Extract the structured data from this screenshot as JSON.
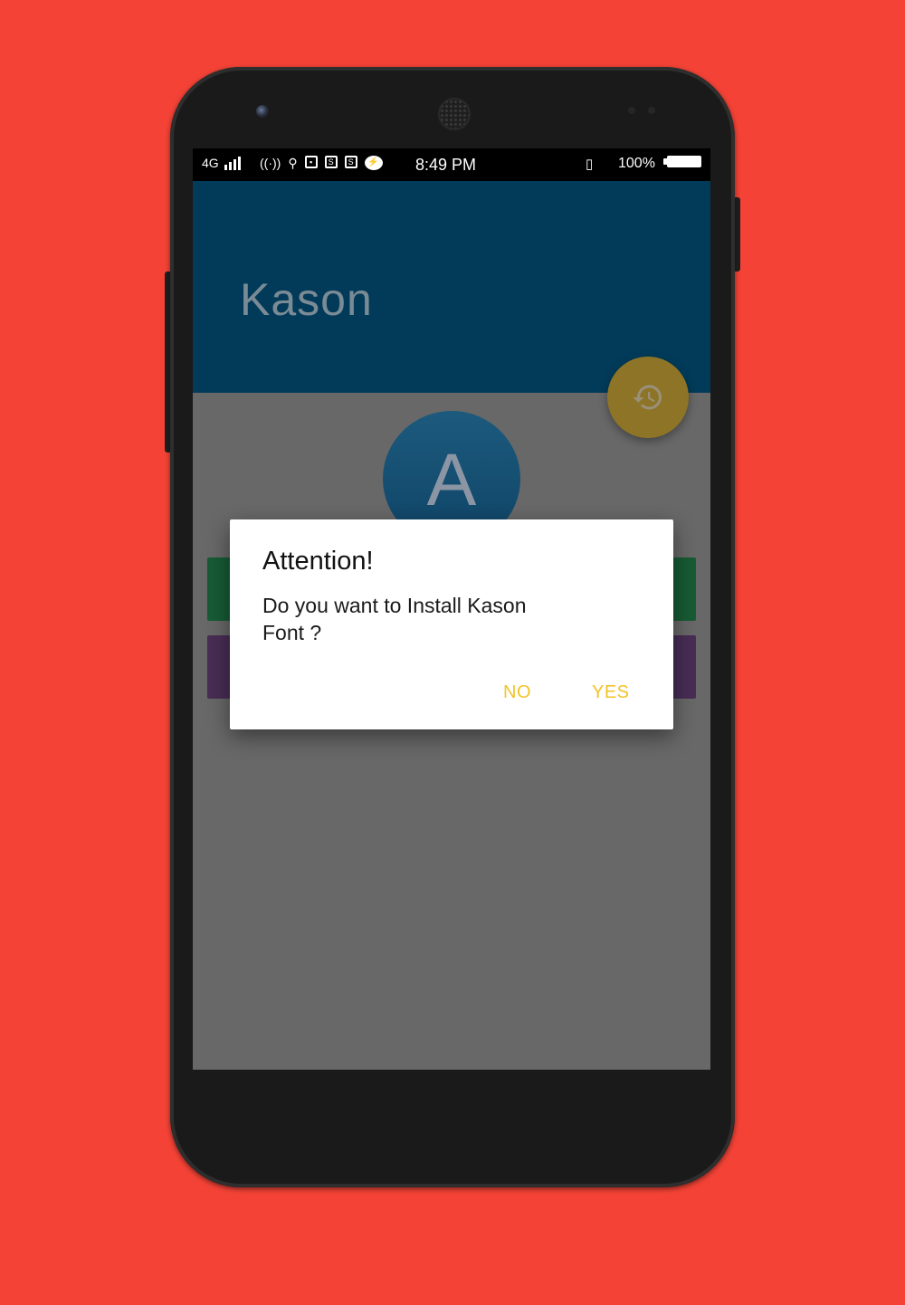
{
  "status_bar": {
    "network": "4G",
    "time": "8:49 PM",
    "battery": "100%",
    "icons": [
      "hotspot-icon",
      "usb-icon",
      "notification-icon",
      "s-icon",
      "s-icon",
      "messenger-icon",
      "vibrate-icon"
    ]
  },
  "app": {
    "title": "Kason",
    "avatar_letter": "A",
    "fab_icon": "history-icon"
  },
  "dialog": {
    "title": "Attention!",
    "message": "Do you want to Install Kason Font ?",
    "no_label": "NO",
    "yes_label": "YES"
  },
  "colors": {
    "background": "#f44336",
    "app_bar": "#023b59",
    "accent": "#f3c327",
    "button_green": "#175b34",
    "button_purple": "#482d55"
  }
}
